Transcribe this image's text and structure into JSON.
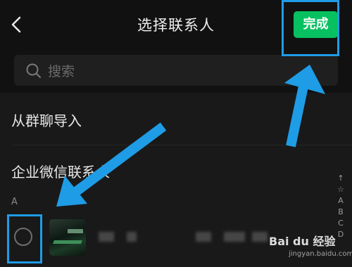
{
  "header": {
    "title": "选择联系人",
    "done_label": "完成"
  },
  "search": {
    "placeholder": "搜索"
  },
  "rows": {
    "from_group": "从群聊导入",
    "wework": "企业微信联系人"
  },
  "contacts": {
    "section_letter": "A"
  },
  "index_bar": [
    "↑",
    "☆",
    "A",
    "B",
    "C",
    "D"
  ],
  "watermark": {
    "brand": "Bai du 经验",
    "site": "jingyan.baidu.com"
  },
  "colors": {
    "accent_green": "#07c160",
    "annotation_blue": "#1f9ce6",
    "background": "#111111"
  },
  "icons": [
    "back-icon",
    "search-icon",
    "checkbox-circle-icon",
    "arrow-annotation"
  ]
}
